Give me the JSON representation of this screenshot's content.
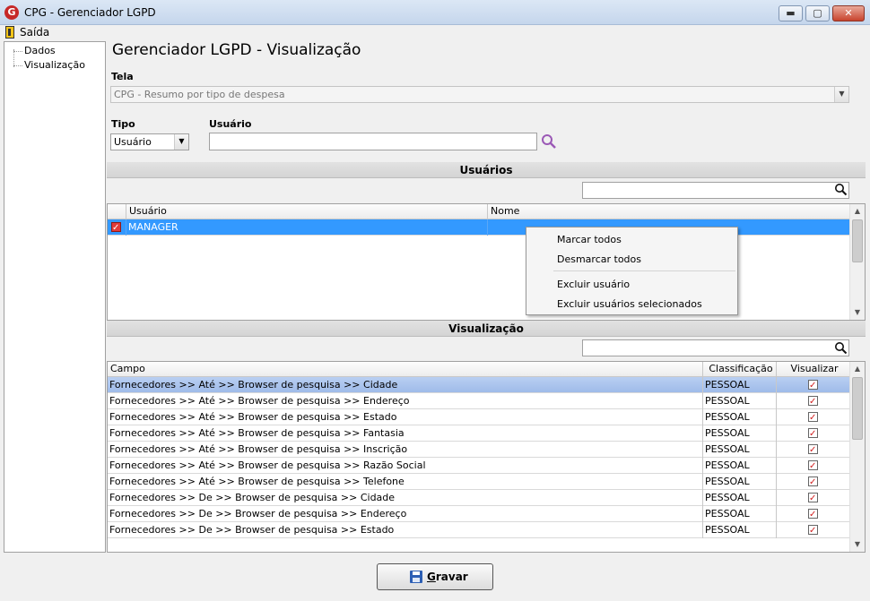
{
  "window": {
    "title": "CPG - Gerenciador LGPD",
    "logo_letter": "G",
    "min": "▬",
    "max": "▢",
    "close": "✕"
  },
  "menu": {
    "exit_label": "Saída"
  },
  "tree": {
    "items": [
      {
        "label": "Dados"
      },
      {
        "label": "Visualização"
      }
    ]
  },
  "page_title": "Gerenciador LGPD - Visualização",
  "tela": {
    "label": "Tela",
    "value": "CPG - Resumo por tipo de despesa"
  },
  "tipo": {
    "label": "Tipo",
    "value": "Usuário"
  },
  "usuario": {
    "label": "Usuário",
    "value": ""
  },
  "users_section": {
    "title": "Usuários",
    "search_value": "",
    "columns": [
      "Usuário",
      "Nome"
    ],
    "rows": [
      {
        "checked": true,
        "usuario": "MANAGER",
        "nome": ""
      }
    ]
  },
  "context_menu": {
    "items": [
      "Marcar todos",
      "Desmarcar todos",
      "Excluir usuário",
      "Excluir usuários selecionados"
    ]
  },
  "view_section": {
    "title": "Visualização",
    "search_value": "",
    "columns": [
      "Campo",
      "Classificação",
      "Visualizar"
    ],
    "rows": [
      {
        "campo": "Fornecedores >> Até >> Browser de pesquisa >> Cidade",
        "classificacao": "PESSOAL",
        "visualizar": true
      },
      {
        "campo": "Fornecedores >> Até >> Browser de pesquisa >> Endereço",
        "classificacao": "PESSOAL",
        "visualizar": true
      },
      {
        "campo": "Fornecedores >> Até >> Browser de pesquisa >> Estado",
        "classificacao": "PESSOAL",
        "visualizar": true
      },
      {
        "campo": "Fornecedores >> Até >> Browser de pesquisa >> Fantasia",
        "classificacao": "PESSOAL",
        "visualizar": true
      },
      {
        "campo": "Fornecedores >> Até >> Browser de pesquisa >> Inscrição",
        "classificacao": "PESSOAL",
        "visualizar": true
      },
      {
        "campo": "Fornecedores >> Até >> Browser de pesquisa >> Razão Social",
        "classificacao": "PESSOAL",
        "visualizar": true
      },
      {
        "campo": "Fornecedores >> Até >> Browser de pesquisa >> Telefone",
        "classificacao": "PESSOAL",
        "visualizar": true
      },
      {
        "campo": "Fornecedores >> De >> Browser de pesquisa >> Cidade",
        "classificacao": "PESSOAL",
        "visualizar": true
      },
      {
        "campo": "Fornecedores >> De >> Browser de pesquisa >> Endereço",
        "classificacao": "PESSOAL",
        "visualizar": true
      },
      {
        "campo": "Fornecedores >> De >> Browser de pesquisa >> Estado",
        "classificacao": "PESSOAL",
        "visualizar": true
      }
    ]
  },
  "save_button": {
    "label_first": "G",
    "label_rest": "ravar"
  }
}
